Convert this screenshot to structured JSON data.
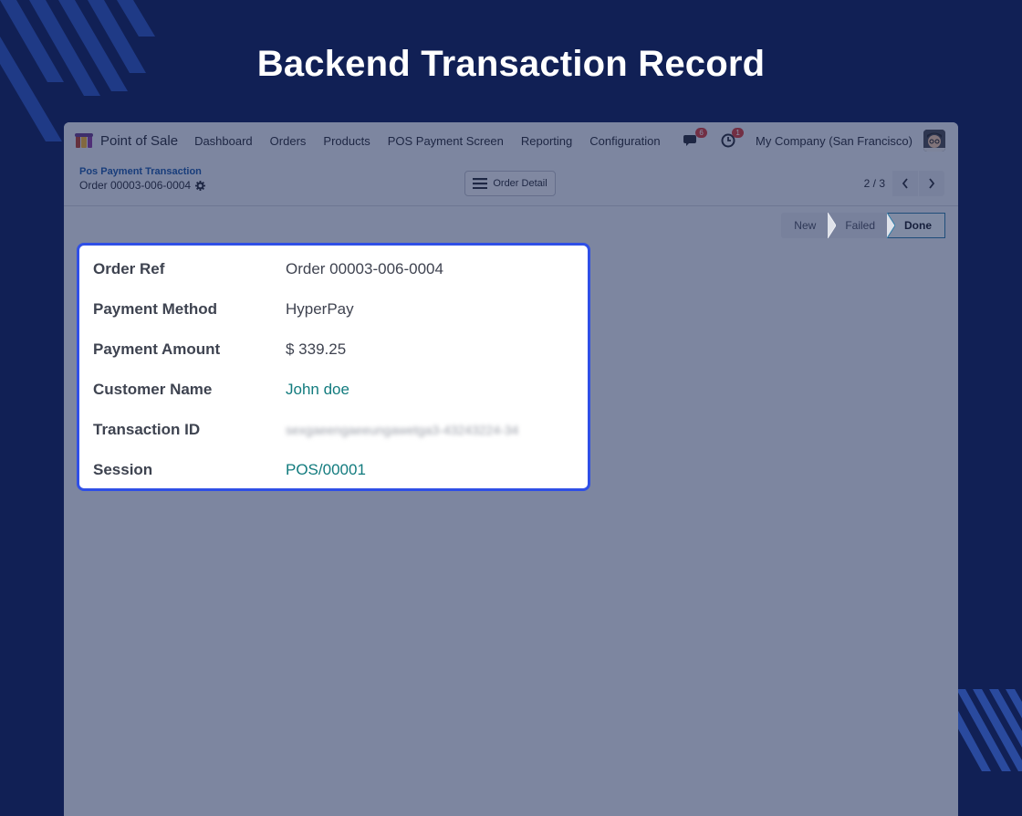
{
  "heading": "Backend Transaction Record",
  "navbar": {
    "app_name": "Point of Sale",
    "menu": [
      "Dashboard",
      "Orders",
      "Products",
      "POS Payment Screen",
      "Reporting",
      "Configuration"
    ],
    "messages_count": "6",
    "activities_count": "1",
    "company": "My Company (San Francisco)",
    "icons": [
      "pos-app-icon",
      "chat-icon",
      "clock-icon",
      "avatar"
    ]
  },
  "controlbar": {
    "breadcrumb_parent": "Pos Payment Transaction",
    "breadcrumb_current": "Order 00003-006-0004",
    "order_detail_label": "Order Detail",
    "pager_value": "2 / 3"
  },
  "statusbar": {
    "steps": [
      "New",
      "Failed",
      "Done"
    ],
    "active": "Done"
  },
  "record": {
    "fields": [
      {
        "label": "Order Ref",
        "value": "Order 00003-006-0004"
      },
      {
        "label": "Payment Method",
        "value": "HyperPay"
      },
      {
        "label": "Payment Amount",
        "value": "$ 339.25"
      },
      {
        "label": "Customer Name",
        "value": "John doe"
      },
      {
        "label": "Transaction ID",
        "value": "sexgaeengaeeungawetga3-43243224-34"
      },
      {
        "label": "Session",
        "value": "POS/00001"
      }
    ]
  },
  "colors": {
    "background": "#112055",
    "highlight_border": "#2f4fe6",
    "link": "#127b7e"
  }
}
